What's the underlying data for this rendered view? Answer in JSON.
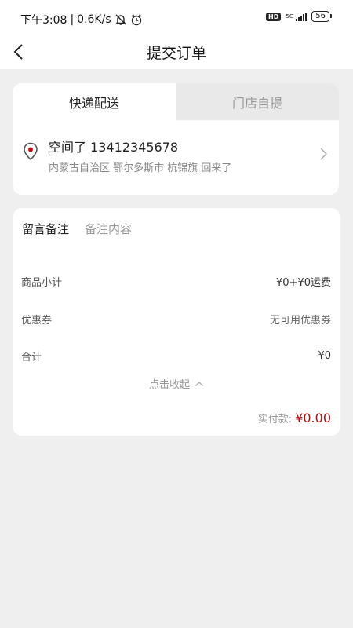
{
  "status_bar": {
    "time": "下午3:08",
    "separator": "|",
    "speed": "0.6K/s",
    "mute_icon": "bell-mute-icon",
    "alarm_icon": "alarm-icon",
    "hd_label": "HD",
    "network_label": "5G",
    "battery": "56"
  },
  "nav": {
    "back_icon": "chevron-left-icon",
    "title": "提交订单"
  },
  "delivery_tabs": [
    {
      "label": "快递配送",
      "active": true
    },
    {
      "label": "门店自提",
      "active": false
    }
  ],
  "address": {
    "icon": "location-pin-icon",
    "name_phone": "空间了 13412345678",
    "detail": "内蒙古自治区 鄂尔多斯市 杭锦旗 回来了",
    "chevron_icon": "chevron-right-icon"
  },
  "remark": {
    "label": "留言备注",
    "placeholder": "备注内容",
    "value": ""
  },
  "summary": {
    "subtotal_label": "商品小计",
    "subtotal_value": "¥0+¥0运费",
    "coupon_label": "优惠券",
    "coupon_value": "无可用优惠券",
    "total_label": "合计",
    "total_value": "¥0",
    "collapse_label": "点击收起",
    "collapse_icon": "chevron-up-icon"
  },
  "payable": {
    "label": "实付款:",
    "amount": "¥0.00"
  },
  "colors": {
    "accent_price": "#b10d0d",
    "background": "#efefef",
    "inactive_tab": "#e9e9e9"
  }
}
